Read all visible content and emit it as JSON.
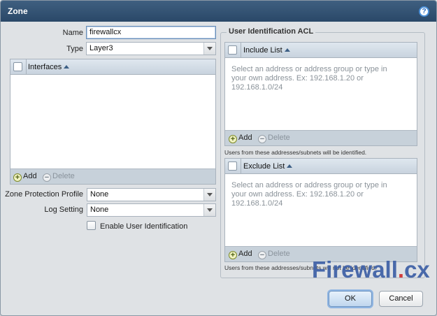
{
  "dialog": {
    "title": "Zone",
    "help_label": "?"
  },
  "form": {
    "name_label": "Name",
    "name_value": "firewallcx",
    "type_label": "Type",
    "type_value": "Layer3",
    "zpp_label": "Zone Protection Profile",
    "zpp_value": "None",
    "log_label": "Log Setting",
    "log_value": "None",
    "enable_uid_label": "Enable User Identification"
  },
  "interfaces": {
    "header": "Interfaces",
    "add_label": "Add",
    "delete_label": "Delete"
  },
  "acl": {
    "legend": "User Identification ACL",
    "include": {
      "header": "Include List",
      "placeholder": "Select an address or address group or type in your own address. Ex: 192.168.1.20 or 192.168.1.0/24",
      "add_label": "Add",
      "delete_label": "Delete",
      "note": "Users from these addresses/subnets will be identified."
    },
    "exclude": {
      "header": "Exclude List",
      "placeholder": "Select an address or address group or type in your own address. Ex: 192.168.1.20 or 192.168.1.0/24",
      "add_label": "Add",
      "delete_label": "Delete",
      "note": "Users from these addresses/subnets will not be identified."
    }
  },
  "buttons": {
    "ok": "OK",
    "cancel": "Cancel"
  },
  "watermark": {
    "text_a": "Firewall",
    "dot": ".",
    "text_b": "cx"
  },
  "colors": {
    "titlebar": "#2f5070",
    "accent": "#6f95c2"
  }
}
